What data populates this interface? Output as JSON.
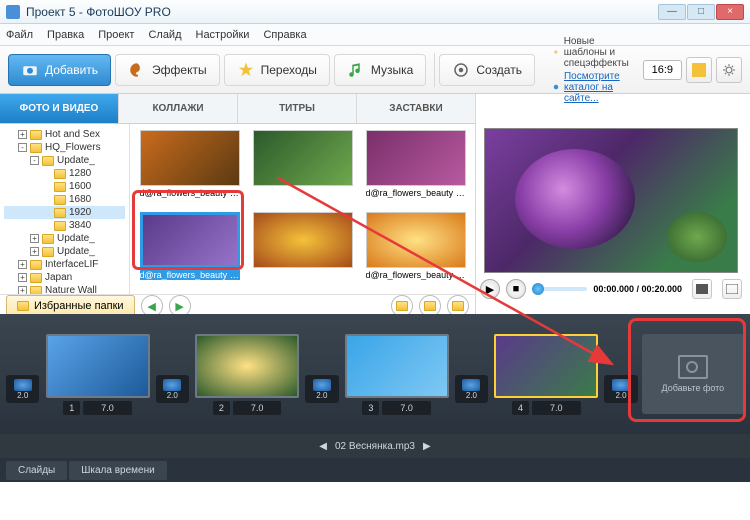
{
  "window": {
    "title": "Проект 5 - ФотоШОУ PRO"
  },
  "menu": {
    "file": "Файл",
    "edit": "Правка",
    "project": "Проект",
    "slide": "Слайд",
    "settings": "Настройки",
    "help": "Справка"
  },
  "toolbar": {
    "add": "Добавить",
    "effects": "Эффекты",
    "transitions": "Переходы",
    "music": "Музыка",
    "create": "Создать",
    "promo1": "Новые шаблоны и спецэффекты",
    "promo2": "Посмотрите каталог на сайте...",
    "ratio": "16:9"
  },
  "tabs": {
    "photo_video": "ФОТО И ВИДЕО",
    "collages": "КОЛЛАЖИ",
    "titles": "ТИТРЫ",
    "splash": "ЗАСТАВКИ"
  },
  "tree": {
    "items": [
      {
        "lvl": "i1",
        "pm": "+",
        "label": "Hot and Sex"
      },
      {
        "lvl": "i1",
        "pm": "-",
        "label": "HQ_Flowers"
      },
      {
        "lvl": "i2",
        "pm": "-",
        "label": "Update_"
      },
      {
        "lvl": "i3",
        "pm": "",
        "label": "1280"
      },
      {
        "lvl": "i3",
        "pm": "",
        "label": "1600"
      },
      {
        "lvl": "i3",
        "pm": "",
        "label": "1680"
      },
      {
        "lvl": "i3",
        "pm": "",
        "label": "1920",
        "sel": true
      },
      {
        "lvl": "i3",
        "pm": "",
        "label": "3840"
      },
      {
        "lvl": "i2",
        "pm": "+",
        "label": "Update_"
      },
      {
        "lvl": "i2",
        "pm": "+",
        "label": "Update_"
      },
      {
        "lvl": "i1",
        "pm": "+",
        "label": "InterfaceLIF"
      },
      {
        "lvl": "i1",
        "pm": "+",
        "label": "Japan"
      },
      {
        "lvl": "i1",
        "pm": "+",
        "label": "Nature Wall"
      }
    ]
  },
  "thumbs": {
    "items": [
      {
        "cap": "d@ra_flowers_beauty (33...",
        "bg": "linear-gradient(135deg,#c96b1d,#5b3a12)"
      },
      {
        "cap": "",
        "bg": "linear-gradient(135deg,#2b5a2b,#6fa84d)"
      },
      {
        "cap": "d@ra_flowers_beauty (45...",
        "bg": "linear-gradient(135deg,#7a2f6a,#b85aa0)"
      },
      {
        "cap": "d@ra_flowers_beauty (46...",
        "bg": "linear-gradient(135deg,#5a3a8a,#9673c9)",
        "sel": true
      },
      {
        "cap": "",
        "bg": "radial-gradient(#f4c23a,#a54a1a)"
      },
      {
        "cap": "d@ra_flowers_beauty (47...",
        "bg": "radial-gradient(#ffe185,#d97a1a)"
      }
    ]
  },
  "filebar": {
    "fav": "Избранные папки"
  },
  "preview": {
    "timecode": "00:00.000 / 00:20.000"
  },
  "timeline": {
    "slides": [
      {
        "idx": "1",
        "dur": "7.0",
        "tdur": "2.0",
        "bg": "linear-gradient(135deg,#5aa3e8,#1c5a9a)"
      },
      {
        "idx": "2",
        "dur": "7.0",
        "tdur": "2.0",
        "bg": "radial-gradient(#ffe185,#2b5a2b)"
      },
      {
        "idx": "3",
        "dur": "7.0",
        "tdur": "2.0",
        "bg": "linear-gradient(135deg,#3aa5e8,#7ec8f4)"
      },
      {
        "idx": "4",
        "dur": "7.0",
        "tdur": "2.0",
        "bg": "linear-gradient(135deg,#5a3a8a,#3a7b4a)",
        "cur": true
      }
    ],
    "add_photo": "Добавьте фото"
  },
  "audio": {
    "track": "02 Веснянка.mp3"
  },
  "bottom": {
    "slides": "Слайды",
    "timeline": "Шкала времени"
  }
}
